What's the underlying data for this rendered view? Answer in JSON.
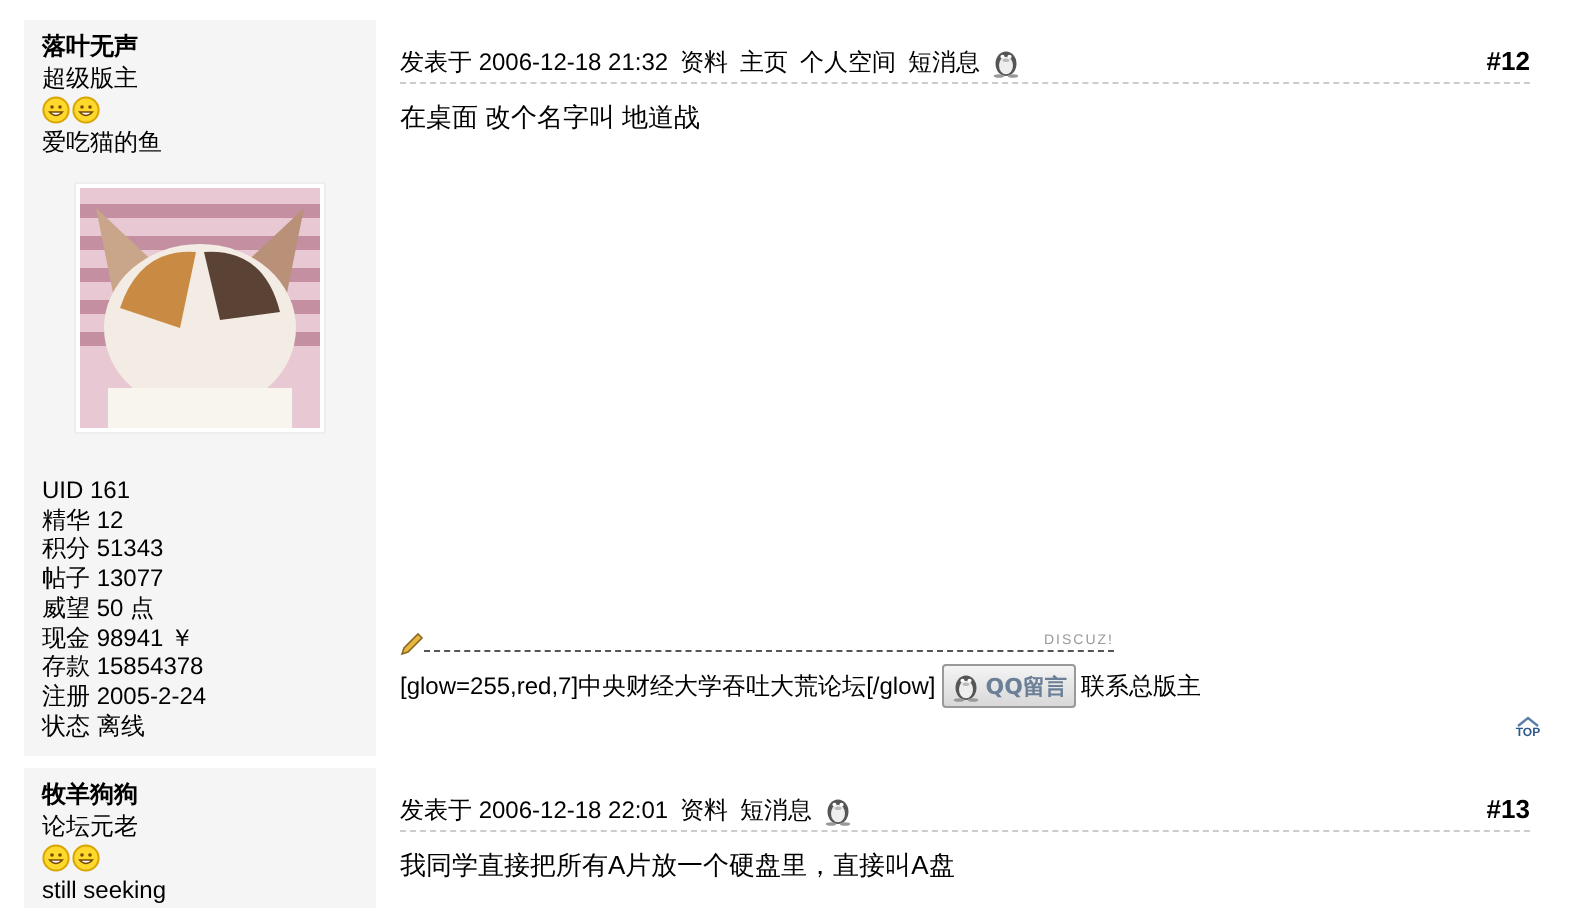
{
  "posts": [
    {
      "author": {
        "name": "落叶无声",
        "rank": "超级版主",
        "rank_icons": [
          {
            "kind": "smiley"
          },
          {
            "kind": "smiley"
          }
        ],
        "signature_line": "爱吃猫的鱼",
        "stats": [
          "UID 161",
          "精华 12",
          "积分 51343",
          "帖子 13077",
          "威望 50 点",
          "现金 98941 ￥",
          "存款 15854378",
          "注册 2005-2-24",
          "状态 离线"
        ]
      },
      "posted": "发表于 2006-12-18 21:32",
      "links": [
        "资料",
        "主页",
        "个人空间",
        "短消息"
      ],
      "number": "#12",
      "message": "在桌面  改个名字叫  地道战",
      "signature": {
        "mark": "DISCUZ!",
        "before": "[glow=255,red,7]中央财经大学吞吐大荒论坛[/glow]",
        "button": "QQ留言",
        "after": "联系总版主"
      },
      "top_label": "TOP"
    },
    {
      "author": {
        "name": "牧羊狗狗",
        "rank": "论坛元老",
        "rank_icons": [
          {
            "kind": "smiley"
          },
          {
            "kind": "smiley"
          }
        ],
        "signature_line": "still seeking"
      },
      "posted": "发表于 2006-12-18 22:01",
      "links": [
        "资料",
        "短消息"
      ],
      "number": "#13",
      "message": "我同学直接把所有A片放一个硬盘里，直接叫A盘"
    }
  ]
}
